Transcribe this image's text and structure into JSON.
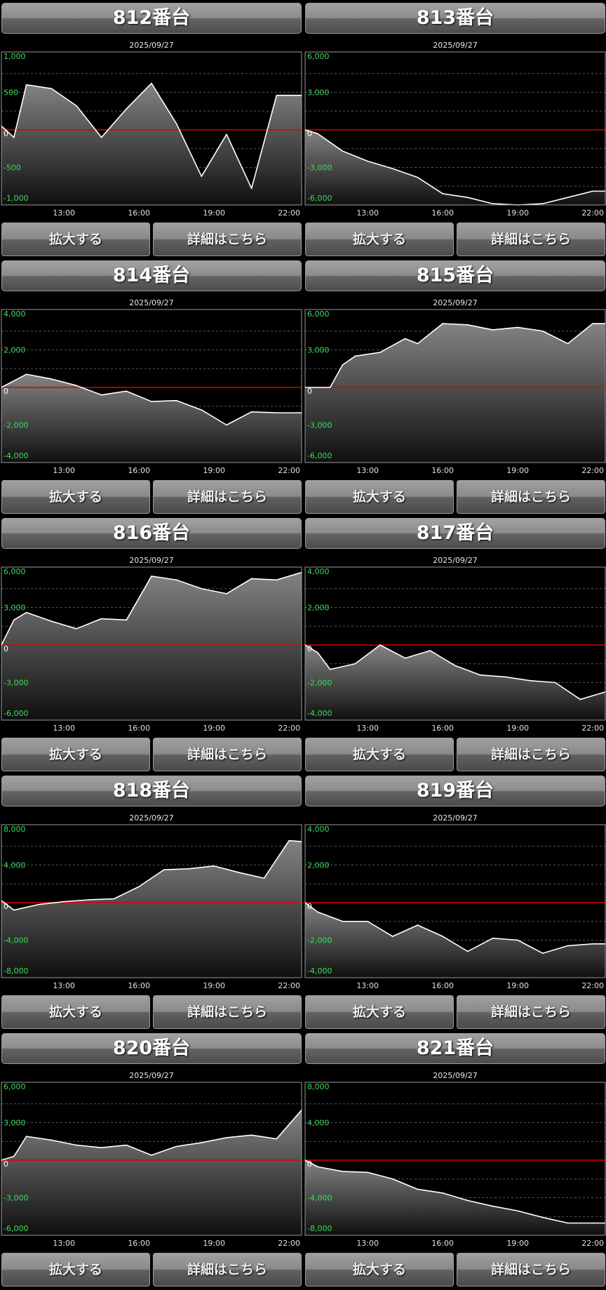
{
  "buttons": {
    "zoom": "拡大する",
    "detail": "詳細はこちら"
  },
  "colors": {
    "ytick": "#3ddc5a",
    "zero_line": "#dd0000",
    "series_line": "#ffffff",
    "grid": "#555555",
    "frame": "#9a9a9a"
  },
  "chart_data": [
    {
      "type": "area",
      "title": "812番台",
      "date": "2025/09/27",
      "x": [
        "11:00",
        "12:00",
        "13:00",
        "14:00",
        "15:00",
        "16:00",
        "17:00",
        "18:00",
        "19:00",
        "20:00",
        "21:00",
        "22:00",
        "23:00"
      ],
      "xticks": [
        "13:00",
        "16:00",
        "19:00",
        "22:00"
      ],
      "yticks": [
        {
          "v": 1000,
          "l": "1,000"
        },
        {
          "v": 500,
          "l": "500"
        },
        {
          "v": 0,
          "l": "0"
        },
        {
          "v": -500,
          "l": "-500"
        },
        {
          "v": -1000,
          "l": "-1,000"
        }
      ],
      "ylim": [
        -1000,
        1000
      ],
      "points": [
        [
          10.5,
          50
        ],
        [
          11,
          -100
        ],
        [
          11.5,
          600
        ],
        [
          12.5,
          550
        ],
        [
          13.5,
          320
        ],
        [
          14.5,
          -100
        ],
        [
          15.5,
          280
        ],
        [
          16.5,
          620
        ],
        [
          17.5,
          80
        ],
        [
          18.5,
          -620
        ],
        [
          19.5,
          -60
        ],
        [
          20.5,
          -780
        ],
        [
          21.5,
          460
        ],
        [
          22.5,
          460
        ]
      ]
    },
    {
      "type": "area",
      "title": "813番台",
      "date": "2025/09/27",
      "x": [
        "11:00",
        "12:00",
        "13:00",
        "14:00",
        "15:00",
        "16:00",
        "17:00",
        "18:00",
        "19:00",
        "20:00",
        "21:00",
        "22:00",
        "23:00"
      ],
      "xticks": [
        "13:00",
        "16:00",
        "19:00",
        "22:00"
      ],
      "yticks": [
        {
          "v": 6000,
          "l": "6,000"
        },
        {
          "v": 3000,
          "l": "3,000"
        },
        {
          "v": 0,
          "l": "0"
        },
        {
          "v": -3000,
          "l": "-3,000"
        },
        {
          "v": -6000,
          "l": "-6,000"
        }
      ],
      "ylim": [
        -6000,
        6000
      ],
      "points": [
        [
          10.5,
          0
        ],
        [
          11,
          -300
        ],
        [
          12,
          -1700
        ],
        [
          13,
          -2500
        ],
        [
          14,
          -3100
        ],
        [
          15,
          -3800
        ],
        [
          16,
          -5100
        ],
        [
          17,
          -5400
        ],
        [
          18,
          -5900
        ],
        [
          19,
          -6000
        ],
        [
          20,
          -5900
        ],
        [
          21,
          -5400
        ],
        [
          22,
          -4900
        ],
        [
          22.5,
          -4900
        ]
      ]
    },
    {
      "type": "area",
      "title": "814番台",
      "date": "2025/09/27",
      "x": [
        "11:00",
        "12:00",
        "13:00",
        "14:00",
        "15:00",
        "16:00",
        "17:00",
        "18:00",
        "19:00",
        "20:00",
        "21:00",
        "22:00",
        "23:00"
      ],
      "xticks": [
        "13:00",
        "16:00",
        "19:00",
        "22:00"
      ],
      "yticks": [
        {
          "v": 4000,
          "l": "4,000"
        },
        {
          "v": 2000,
          "l": "2,000"
        },
        {
          "v": 0,
          "l": "0"
        },
        {
          "v": -2000,
          "l": "-2,000"
        },
        {
          "v": -4000,
          "l": "-4,000"
        }
      ],
      "ylim": [
        -4000,
        4000
      ],
      "points": [
        [
          10.5,
          0
        ],
        [
          11.5,
          700
        ],
        [
          12.5,
          450
        ],
        [
          13.5,
          100
        ],
        [
          14.5,
          -400
        ],
        [
          15.5,
          -200
        ],
        [
          16.5,
          -750
        ],
        [
          17.5,
          -700
        ],
        [
          18.5,
          -1200
        ],
        [
          19.5,
          -2000
        ],
        [
          20.5,
          -1300
        ],
        [
          21.5,
          -1350
        ],
        [
          22.5,
          -1350
        ]
      ]
    },
    {
      "type": "area",
      "title": "815番台",
      "date": "2025/09/27",
      "x": [
        "11:00",
        "12:00",
        "13:00",
        "14:00",
        "15:00",
        "16:00",
        "17:00",
        "18:00",
        "19:00",
        "20:00",
        "21:00",
        "22:00",
        "23:00"
      ],
      "xticks": [
        "13:00",
        "16:00",
        "19:00",
        "22:00"
      ],
      "yticks": [
        {
          "v": 6000,
          "l": "6,000"
        },
        {
          "v": 3000,
          "l": "3,000"
        },
        {
          "v": 0,
          "l": "0"
        },
        {
          "v": -3000,
          "l": "-3,000"
        },
        {
          "v": -6000,
          "l": "-6,000"
        }
      ],
      "ylim": [
        -6000,
        6000
      ],
      "points": [
        [
          10.5,
          0
        ],
        [
          11.5,
          0
        ],
        [
          12,
          1800
        ],
        [
          12.5,
          2500
        ],
        [
          13.5,
          2800
        ],
        [
          14.5,
          3900
        ],
        [
          15,
          3500
        ],
        [
          16,
          5100
        ],
        [
          17,
          5000
        ],
        [
          18,
          4600
        ],
        [
          19,
          4800
        ],
        [
          20,
          4500
        ],
        [
          21,
          3500
        ],
        [
          22,
          5100
        ],
        [
          22.5,
          5100
        ]
      ]
    },
    {
      "type": "area",
      "title": "816番台",
      "date": "2025/09/27",
      "x": [
        "11:00",
        "12:00",
        "13:00",
        "14:00",
        "15:00",
        "16:00",
        "17:00",
        "18:00",
        "19:00",
        "20:00",
        "21:00",
        "22:00",
        "23:00"
      ],
      "xticks": [
        "13:00",
        "16:00",
        "19:00",
        "22:00"
      ],
      "yticks": [
        {
          "v": 6000,
          "l": "6,000"
        },
        {
          "v": 3000,
          "l": "3,000"
        },
        {
          "v": 0,
          "l": "0"
        },
        {
          "v": -3000,
          "l": "-3,000"
        },
        {
          "v": -6000,
          "l": "-6,000"
        }
      ],
      "ylim": [
        -6000,
        6000
      ],
      "points": [
        [
          10.5,
          0
        ],
        [
          11,
          2000
        ],
        [
          11.5,
          2600
        ],
        [
          12.5,
          1900
        ],
        [
          13.5,
          1300
        ],
        [
          14.5,
          2100
        ],
        [
          15.5,
          2000
        ],
        [
          16.5,
          5500
        ],
        [
          17.5,
          5200
        ],
        [
          18.5,
          4500
        ],
        [
          19.5,
          4100
        ],
        [
          20.5,
          5300
        ],
        [
          21.5,
          5200
        ],
        [
          22.5,
          5800
        ]
      ]
    },
    {
      "type": "area",
      "title": "817番台",
      "date": "2025/09/27",
      "x": [
        "11:00",
        "12:00",
        "13:00",
        "14:00",
        "15:00",
        "16:00",
        "17:00",
        "18:00",
        "19:00",
        "20:00",
        "21:00",
        "22:00",
        "23:00"
      ],
      "xticks": [
        "13:00",
        "16:00",
        "19:00",
        "22:00"
      ],
      "yticks": [
        {
          "v": 4000,
          "l": "4,000"
        },
        {
          "v": 2000,
          "l": "2,000"
        },
        {
          "v": 0,
          "l": "0"
        },
        {
          "v": -2000,
          "l": "-2,000"
        },
        {
          "v": -4000,
          "l": "-4,000"
        }
      ],
      "ylim": [
        -4000,
        4000
      ],
      "points": [
        [
          10.5,
          0
        ],
        [
          11,
          -400
        ],
        [
          11.5,
          -1300
        ],
        [
          12.5,
          -1000
        ],
        [
          13.5,
          0
        ],
        [
          14.5,
          -700
        ],
        [
          15.5,
          -300
        ],
        [
          16.5,
          -1100
        ],
        [
          17.5,
          -1600
        ],
        [
          18.5,
          -1700
        ],
        [
          19.5,
          -1900
        ],
        [
          20.5,
          -2000
        ],
        [
          21.5,
          -2900
        ],
        [
          22.5,
          -2500
        ]
      ]
    },
    {
      "type": "area",
      "title": "818番台",
      "date": "2025/09/27",
      "x": [
        "11:00",
        "12:00",
        "13:00",
        "14:00",
        "15:00",
        "16:00",
        "17:00",
        "18:00",
        "19:00",
        "20:00",
        "21:00",
        "22:00",
        "23:00"
      ],
      "xticks": [
        "13:00",
        "16:00",
        "19:00",
        "22:00"
      ],
      "yticks": [
        {
          "v": 8000,
          "l": "8,000"
        },
        {
          "v": 4000,
          "l": "4,000"
        },
        {
          "v": 0,
          "l": "0"
        },
        {
          "v": -4000,
          "l": "-4,000"
        },
        {
          "v": -8000,
          "l": "-8,000"
        }
      ],
      "ylim": [
        -8000,
        8000
      ],
      "points": [
        [
          10.5,
          200
        ],
        [
          11,
          -800
        ],
        [
          12,
          -200
        ],
        [
          13,
          100
        ],
        [
          14,
          300
        ],
        [
          15,
          400
        ],
        [
          16,
          1700
        ],
        [
          17,
          3500
        ],
        [
          18,
          3600
        ],
        [
          19,
          3900
        ],
        [
          20,
          3200
        ],
        [
          21,
          2600
        ],
        [
          22,
          6600
        ],
        [
          22.5,
          6500
        ]
      ]
    },
    {
      "type": "area",
      "title": "819番台",
      "date": "2025/09/27",
      "x": [
        "11:00",
        "12:00",
        "13:00",
        "14:00",
        "15:00",
        "16:00",
        "17:00",
        "18:00",
        "19:00",
        "20:00",
        "21:00",
        "22:00",
        "23:00"
      ],
      "xticks": [
        "13:00",
        "16:00",
        "19:00",
        "22:00"
      ],
      "yticks": [
        {
          "v": 4000,
          "l": "4,000"
        },
        {
          "v": 2000,
          "l": "2,000"
        },
        {
          "v": 0,
          "l": "0"
        },
        {
          "v": -2000,
          "l": "-2,000"
        },
        {
          "v": -4000,
          "l": "-4,000"
        }
      ],
      "ylim": [
        -4000,
        4000
      ],
      "points": [
        [
          10.5,
          0
        ],
        [
          11,
          -500
        ],
        [
          12,
          -1000
        ],
        [
          13,
          -1000
        ],
        [
          14,
          -1800
        ],
        [
          15,
          -1200
        ],
        [
          16,
          -1800
        ],
        [
          17,
          -2600
        ],
        [
          18,
          -1900
        ],
        [
          19,
          -2000
        ],
        [
          20,
          -2700
        ],
        [
          21,
          -2300
        ],
        [
          22,
          -2200
        ],
        [
          22.5,
          -2200
        ]
      ]
    },
    {
      "type": "area",
      "title": "820番台",
      "date": "2025/09/27",
      "x": [
        "11:00",
        "12:00",
        "13:00",
        "14:00",
        "15:00",
        "16:00",
        "17:00",
        "18:00",
        "19:00",
        "20:00",
        "21:00",
        "22:00",
        "23:00"
      ],
      "xticks": [
        "13:00",
        "16:00",
        "19:00",
        "22:00"
      ],
      "yticks": [
        {
          "v": 6000,
          "l": "6,000"
        },
        {
          "v": 3000,
          "l": "3,000"
        },
        {
          "v": 0,
          "l": "0"
        },
        {
          "v": -3000,
          "l": "-3,000"
        },
        {
          "v": -6000,
          "l": "-6,000"
        }
      ],
      "ylim": [
        -6000,
        6000
      ],
      "points": [
        [
          10.5,
          0
        ],
        [
          11,
          300
        ],
        [
          11.5,
          1900
        ],
        [
          12.5,
          1600
        ],
        [
          13.5,
          1200
        ],
        [
          14.5,
          1000
        ],
        [
          15.5,
          1200
        ],
        [
          16.5,
          400
        ],
        [
          17.5,
          1100
        ],
        [
          18.5,
          1400
        ],
        [
          19.5,
          1800
        ],
        [
          20.5,
          2000
        ],
        [
          21.5,
          1700
        ],
        [
          22.5,
          4000
        ]
      ]
    },
    {
      "type": "area",
      "title": "821番台",
      "date": "2025/09/27",
      "x": [
        "11:00",
        "12:00",
        "13:00",
        "14:00",
        "15:00",
        "16:00",
        "17:00",
        "18:00",
        "19:00",
        "20:00",
        "21:00",
        "22:00",
        "23:00"
      ],
      "xticks": [
        "13:00",
        "16:00",
        "19:00",
        "22:00"
      ],
      "yticks": [
        {
          "v": 8000,
          "l": "8,000"
        },
        {
          "v": 4000,
          "l": "4,000"
        },
        {
          "v": 0,
          "l": "0"
        },
        {
          "v": -4000,
          "l": "-4,000"
        },
        {
          "v": -8000,
          "l": "-8,000"
        }
      ],
      "ylim": [
        -8000,
        8000
      ],
      "points": [
        [
          10.5,
          0
        ],
        [
          11,
          -700
        ],
        [
          12,
          -1200
        ],
        [
          13,
          -1300
        ],
        [
          14,
          -2000
        ],
        [
          15,
          -3100
        ],
        [
          16,
          -3500
        ],
        [
          17,
          -4300
        ],
        [
          18,
          -4900
        ],
        [
          19,
          -5400
        ],
        [
          20,
          -6100
        ],
        [
          21,
          -6700
        ],
        [
          22,
          -6700
        ],
        [
          22.5,
          -6700
        ]
      ]
    }
  ]
}
